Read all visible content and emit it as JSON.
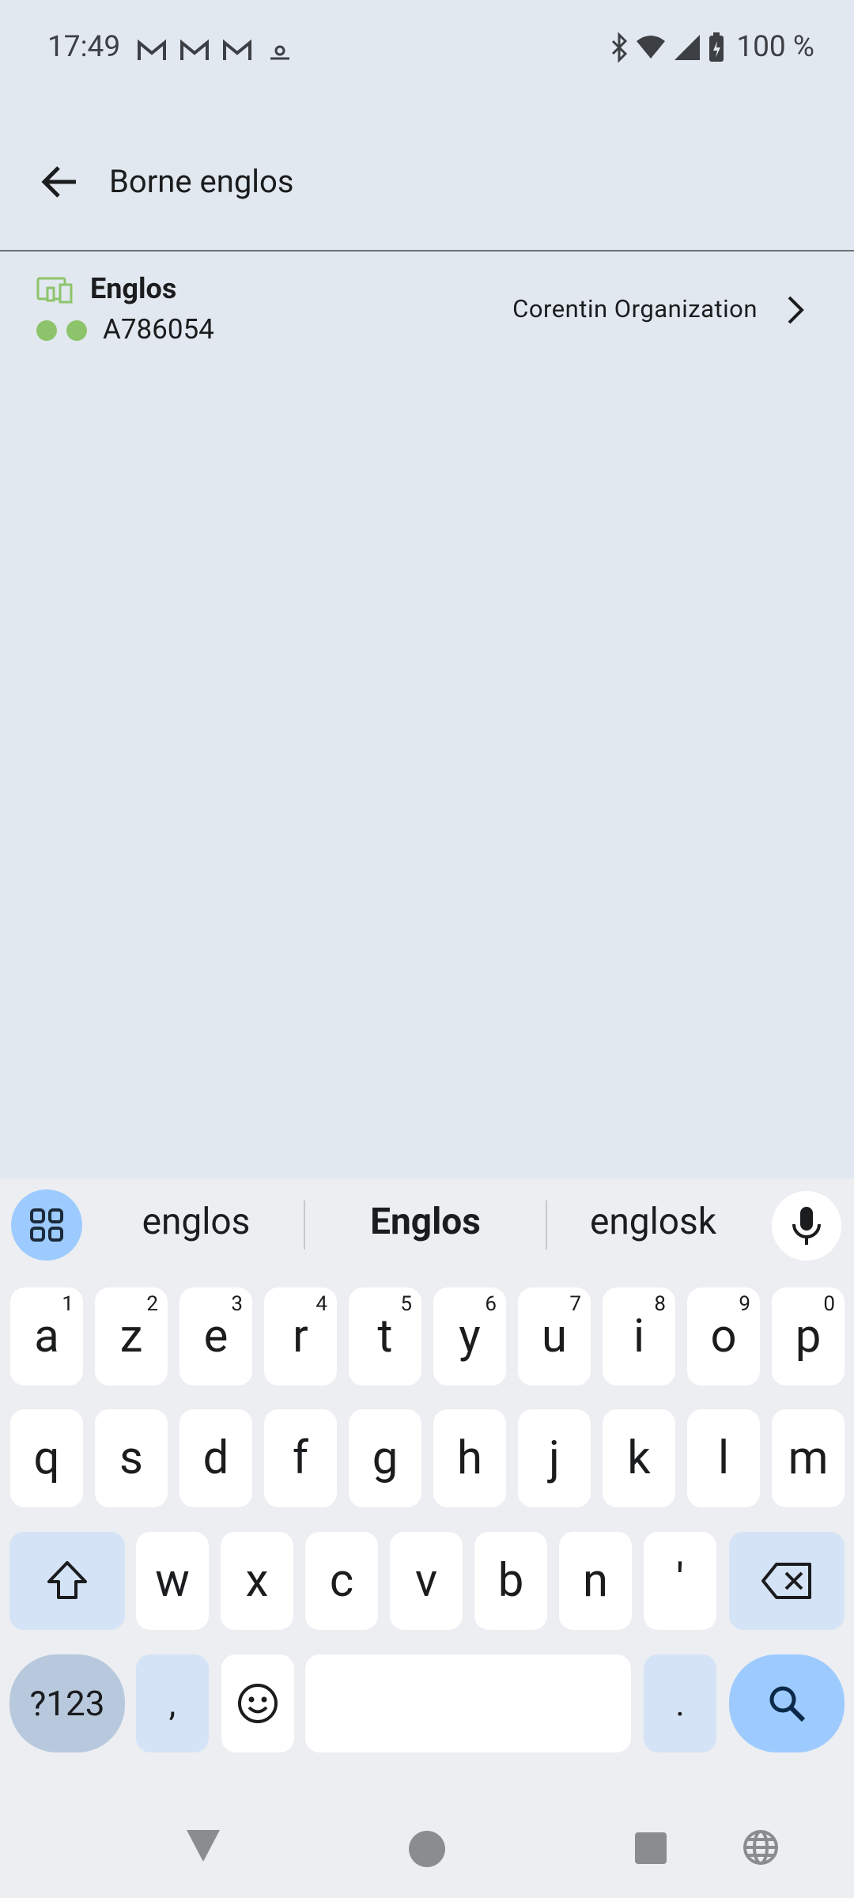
{
  "status_bar": {
    "time": "17:49",
    "battery": "100 %"
  },
  "app_bar": {
    "title": "Borne englos"
  },
  "results": [
    {
      "name": "Englos",
      "serial": "A786054",
      "organization": "Corentin Organization",
      "status_color": "#8dc46b"
    }
  ],
  "keyboard": {
    "suggestions": [
      "englos",
      "Englos",
      "englosk"
    ],
    "row1": [
      {
        "k": "a",
        "s": "1"
      },
      {
        "k": "z",
        "s": "2"
      },
      {
        "k": "e",
        "s": "3"
      },
      {
        "k": "r",
        "s": "4"
      },
      {
        "k": "t",
        "s": "5"
      },
      {
        "k": "y",
        "s": "6"
      },
      {
        "k": "u",
        "s": "7"
      },
      {
        "k": "i",
        "s": "8"
      },
      {
        "k": "o",
        "s": "9"
      },
      {
        "k": "p",
        "s": "0"
      }
    ],
    "row2": [
      "q",
      "s",
      "d",
      "f",
      "g",
      "h",
      "j",
      "k",
      "l",
      "m"
    ],
    "row3": [
      "w",
      "x",
      "c",
      "v",
      "b",
      "n",
      "'"
    ],
    "symbols_label": "?123",
    "comma": ",",
    "period": "."
  }
}
